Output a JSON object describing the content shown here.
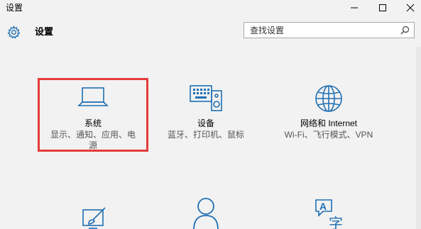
{
  "window": {
    "title": "设置"
  },
  "header": {
    "title": "设置",
    "icon": "gear-icon"
  },
  "search": {
    "placeholder": "查找设置",
    "icon": "search-icon"
  },
  "colors": {
    "accent": "#1f6fb2",
    "highlight": "#e43b3b",
    "background": "#f2f2f2"
  },
  "tiles": [
    {
      "id": "system",
      "title": "系统",
      "desc": "显示、通知、应用、电源",
      "icon": "laptop-icon",
      "highlighted": true
    },
    {
      "id": "devices",
      "title": "设备",
      "desc": "蓝牙、打印机、鼠标",
      "icon": "keyboard-speaker-icon"
    },
    {
      "id": "network",
      "title": "网络和 Internet",
      "desc": "Wi-Fi、飞行模式、VPN",
      "icon": "globe-icon"
    },
    {
      "id": "personalization",
      "icon": "paintbrush-monitor-icon"
    },
    {
      "id": "accounts",
      "icon": "person-icon"
    },
    {
      "id": "time-language",
      "icon": "language-icon",
      "icon_text": "A字"
    }
  ]
}
